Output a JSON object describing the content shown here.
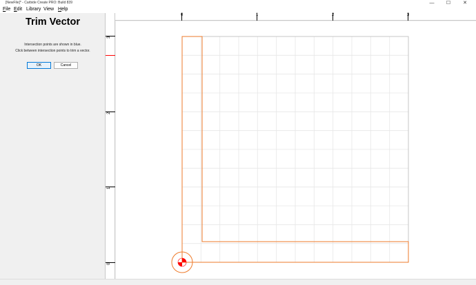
{
  "window": {
    "title": "[NewFile]* - Carbide Create PRO: Build 839",
    "controls": {
      "minimize": "—",
      "maximize": "☐",
      "close": "✕"
    }
  },
  "menu": {
    "items": [
      {
        "label": "File",
        "mnemonic": "F",
        "rest": "ile"
      },
      {
        "label": "Edit",
        "mnemonic": "E",
        "rest": "dit"
      },
      {
        "label": "Library",
        "mnemonic": "",
        "rest": "Library"
      },
      {
        "label": "View",
        "mnemonic": "",
        "rest": "View"
      },
      {
        "label": "Help",
        "mnemonic": "H",
        "rest": "elp"
      }
    ]
  },
  "panel": {
    "title": "Trim Vector",
    "line1": "Intersection points are shown in blue.",
    "line2": "Click between intersection points to trim a vector.",
    "ok_label": "OK",
    "cancel_label": "Cancel"
  },
  "rulers": {
    "horizontal_labels": [
      "0",
      "1",
      "2",
      "3"
    ],
    "vertical_labels": [
      "3",
      "2",
      "1",
      "0"
    ]
  },
  "colors": {
    "vector_orange": "#ee7a2a",
    "grid": "#e6e6e6",
    "origin_red": "#ff0000",
    "ruler_marker_red": "#ff0000"
  }
}
